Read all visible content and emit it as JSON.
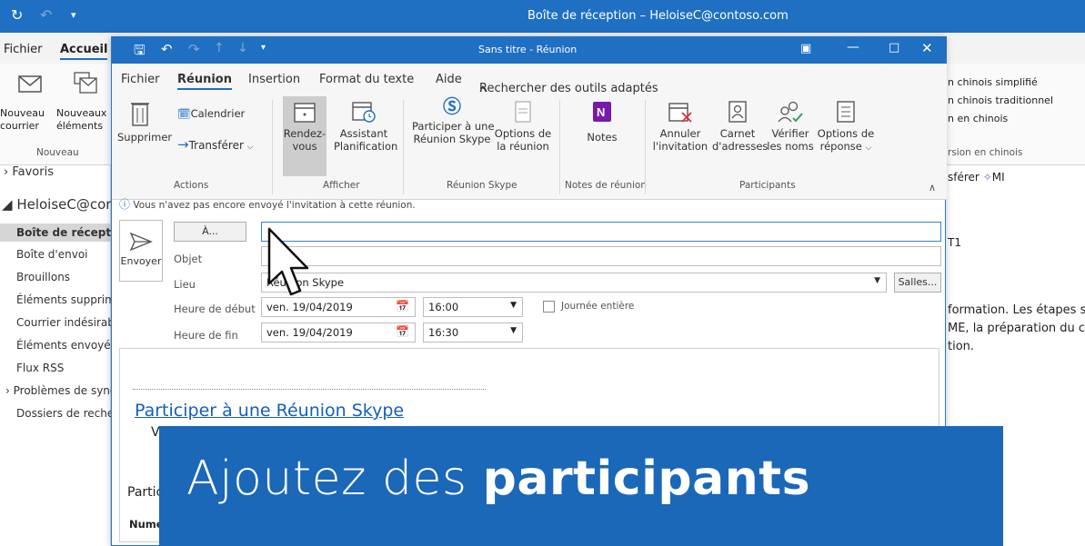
{
  "outlook": {
    "title": "Boîte de réception – HeloiseC@contoso.com",
    "tabs": {
      "fichier": "Fichier",
      "accueil": "Accueil"
    },
    "ribbon_left": {
      "nouveau_courrier_1": "Nouveau",
      "nouveau_courrier_2": "courrier",
      "nouveaux_elements_1": "Nouveaux",
      "nouveaux_elements_2": "éléments",
      "group": "Nouveau"
    },
    "ribbon_right": {
      "line1": "n chinois simplifié",
      "line2": "n chinois traditionnel",
      "line3": "n en chinois",
      "group": "rsion en chinois"
    },
    "nav": {
      "favoris": "Favoris",
      "account": "HeloiseC@cor",
      "items": [
        "Boîte de réceptio",
        "Boîte d'envoi",
        "Brouillons",
        "Éléments supprimé",
        "Courrier indésirabl",
        "Éléments envoyés",
        "Flux RSS",
        "Problèmes de sync",
        "Dossiers de recherc"
      ]
    },
    "reading": {
      "toolbar": "sférer",
      "mi": "MI",
      "t1": "T1",
      "text1": "formation. Les étapes su",
      "text2": "ME, la préparation du co",
      "text3": "tion."
    }
  },
  "meeting": {
    "title": "Sans titre - Réunion",
    "tabs": [
      "Fichier",
      "Réunion",
      "Insertion",
      "Format du texte",
      "Aide"
    ],
    "search": "Rechercher des outils adaptés",
    "ribbon": {
      "supprimer": "Supprimer",
      "calendrier": "Calendrier",
      "transferer": "Transférer",
      "actions": "Actions",
      "rendezvous_1": "Rendez-",
      "rendezvous_2": "vous",
      "assistant_1": "Assistant",
      "assistant_2": "Planification",
      "afficher": "Afficher",
      "participer_1": "Participer à une",
      "participer_2": "Réunion Skype",
      "options_1": "Options de",
      "options_2": "la réunion",
      "skype_group": "Réunion Skype",
      "notes": "Notes",
      "notes_group": "Notes de réunion",
      "annuler_1": "Annuler",
      "annuler_2": "l'invitation",
      "carnet_1": "Carnet",
      "carnet_2": "d'adresses",
      "verifier_1": "Vérifier",
      "verifier_2": "les noms",
      "optrep_1": "Options de",
      "optrep_2": "réponse",
      "participants": "Participants"
    },
    "info": "Vous n'avez pas encore envoyé l'invitation à cette réunion.",
    "form": {
      "send": "Envoyer",
      "to_button": "À...",
      "subject_label": "Objet",
      "location_label": "Lieu",
      "location_value": "Réunion Skype",
      "rooms_button": "Salles...",
      "start_label": "Heure de début",
      "start_date": "ven. 19/04/2019",
      "start_time": "16:00",
      "all_day": "Journée entière",
      "end_label": "Heure de fin",
      "end_date": "ven. 19/04/2019",
      "end_time": "16:30"
    },
    "body": {
      "link": "Participer à une Réunion Skype",
      "v": "V",
      "partic": "Partic",
      "numero": "Numé"
    }
  },
  "caption": {
    "light": "Ajoutez des ",
    "bold": "participants"
  }
}
